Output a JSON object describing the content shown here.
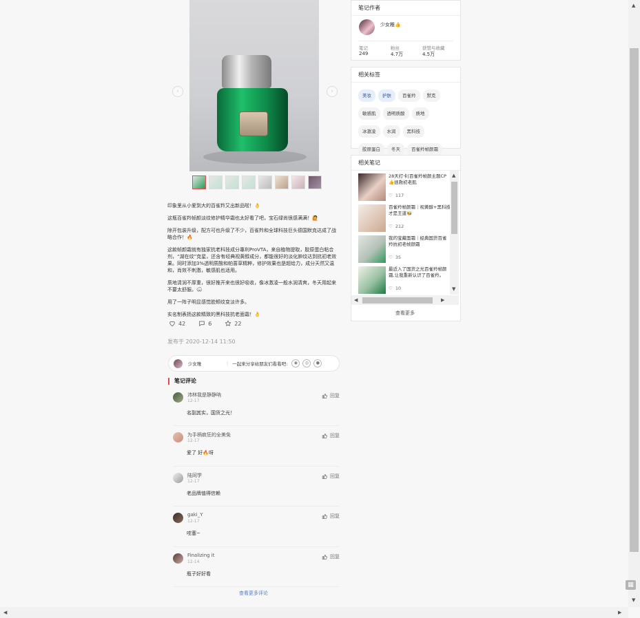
{
  "note": {
    "paragraphs": [
      "印象里从小爱到大的百雀羚又出新品啦！👌",
      "这瓶百雀羚帧颜淡纹修护精华霜也太好看了吧，宝石绿尚很感满满！🙋",
      "除开包装升级，配方可也升级了不少，百雀羚和全球科技巨头德国默克达成了战略合作！🔥",
      "这款帧颜霜就有独家抗老科技成分專利ProVTA，来自植物提取，胶原蛋白粘合剂，“湖在纹”克星，还含有经典视黄醇成分，都能很好的淡化肿纹达到抗初老效果。同时添加3%透明质酸和帕蔷草精粹，修护效果也是超给力，成分天然又温和，肖效不刺激，敏感肌也适用。",
      "质地清润不厚重，很好推开来也很好吸收，像冰激凌一般水润清爽，冬天用起来不要太舒服。🌨",
      "用了一阵子明显感觉脸颊纹变淡许多。",
      "实名制表扬这款精致的黑科技抗老面霜！👌"
    ],
    "stats": {
      "likes": "42",
      "comments": "6",
      "collects": "22"
    },
    "published": "发布于 2020-12-14 11:50"
  },
  "share": {
    "author": "少女稚",
    "prompt": "一起来分享给朋友们看看吧:"
  },
  "comments_title": "笔记评论",
  "comments": [
    {
      "name": "沛林我是静静呐",
      "date": "12-17",
      "text": "名副其实，国货之光！"
    },
    {
      "name": "为手柄疯狂的全美免",
      "date": "12-17",
      "text": "爱了 好🔥呀"
    },
    {
      "name": "陆同学",
      "date": "12-17",
      "text": "老品牌值得信赖"
    },
    {
      "name": "gaki_Y",
      "date": "12-17",
      "text": "哇塞~"
    },
    {
      "name": "Finalizing it",
      "date": "12-14",
      "text": "瓶子好好看"
    }
  ],
  "reply_label": "回复",
  "more_comments": "查看更多评论",
  "author_card": {
    "title": "笔记作者",
    "name": "少女稚👍",
    "stats": [
      {
        "label": "笔记",
        "value": "249"
      },
      {
        "label": "粉丝",
        "value": "4.7万"
      },
      {
        "label": "获赞与收藏",
        "value": "4.5万"
      }
    ]
  },
  "tags_card": {
    "title": "相关标签",
    "tags": [
      "美妆",
      "护肤",
      "百雀羚",
      "默克",
      "敏感肌",
      "透明质酸",
      "质地",
      "冰激凌",
      "水润",
      "黑科技",
      "胶原蛋白",
      "冬天",
      "百雀羚帧颜霜"
    ]
  },
  "related_card": {
    "title": "相关笔记",
    "items": [
      {
        "text": "28天打卡|百雀羚帧颜主题CP👍拯救初老肌",
        "likes": "117"
      },
      {
        "text": "百雀羚帧颜霜｜视黄醇+黑科技才是王道🐝",
        "likes": "212"
      },
      {
        "text": "我的宝藏面霜｜经典国货百雀羚抗初老帧颜霜",
        "likes": "35"
      },
      {
        "text": "最近入了国货之光百雀羚帧颜霜,让我重新认识了百雀羚。",
        "likes": "10"
      }
    ],
    "more": "查看更多"
  },
  "colors": {
    "accent": "#e5484d",
    "link": "#5a7fbf",
    "tag_highlight": "#e6eefb"
  }
}
